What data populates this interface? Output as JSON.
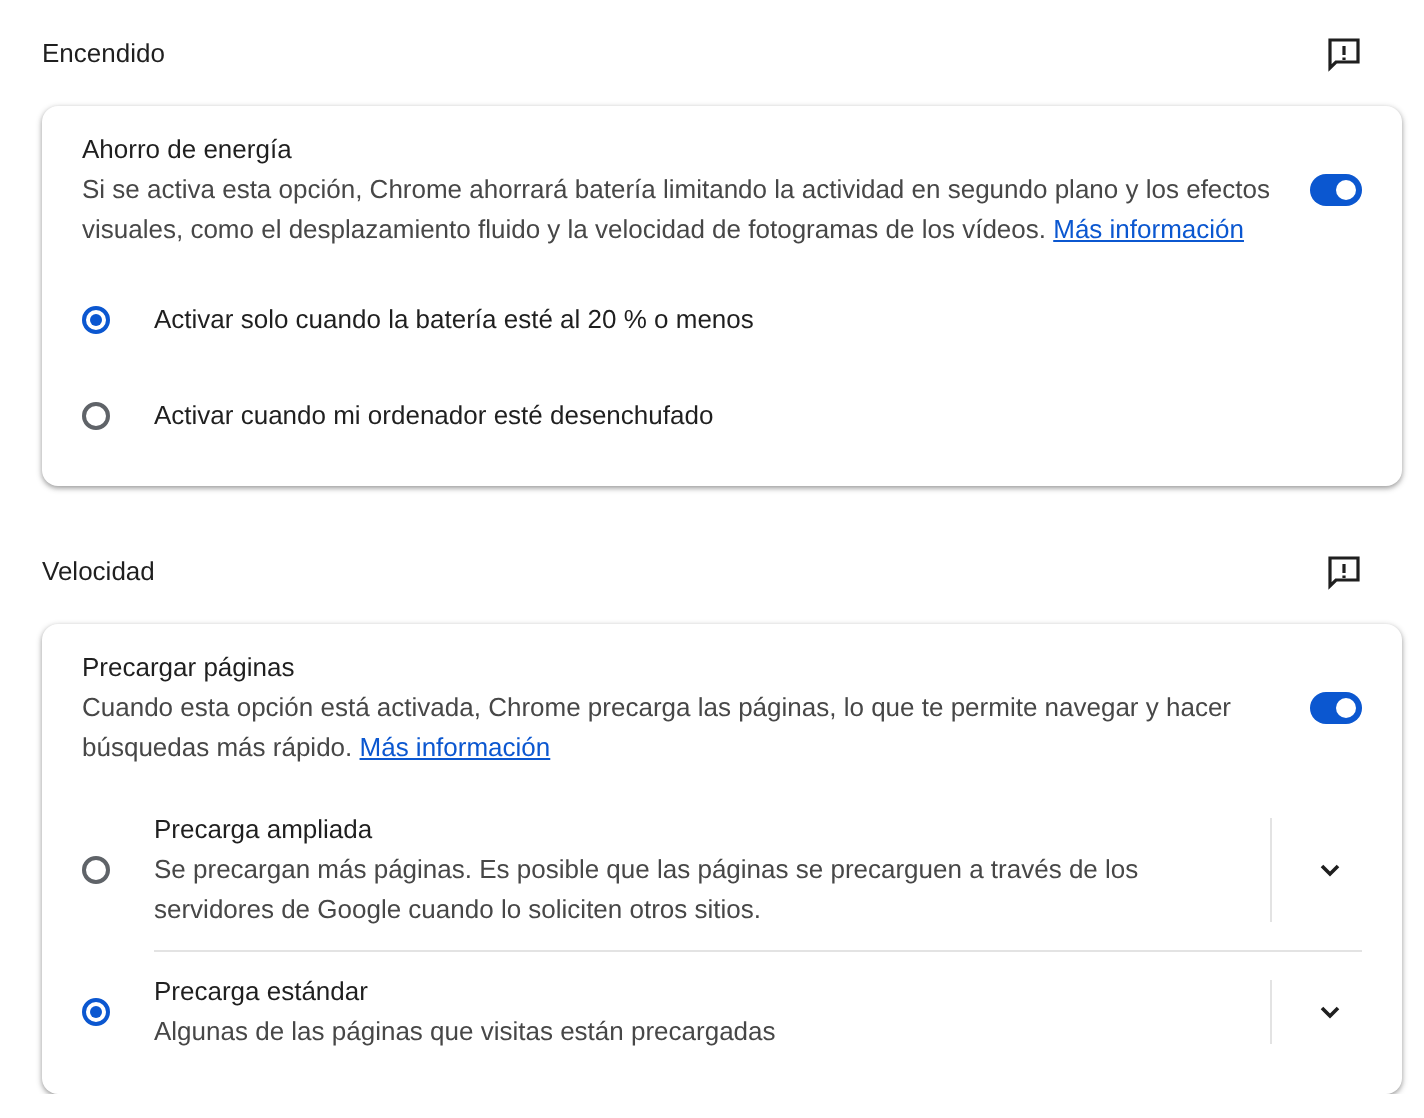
{
  "sections": [
    {
      "title": "Encendido",
      "setting": {
        "title": "Ahorro de energía",
        "description": "Si se activa esta opción, Chrome ahorrará batería limitando la actividad en segundo plano y los efectos visuales, como el desplazamiento fluido y la velocidad de fotogramas de los vídeos.",
        "link": "Más información",
        "on": true
      },
      "options": [
        {
          "kind": "simple",
          "label": "Activar solo cuando la batería esté al 20 % o menos",
          "selected": true
        },
        {
          "kind": "simple",
          "label": "Activar cuando mi ordenador esté desenchufado",
          "selected": false
        }
      ]
    },
    {
      "title": "Velocidad",
      "setting": {
        "title": "Precargar páginas",
        "description": "Cuando esta opción está activada, Chrome precarga las páginas, lo que te permite navegar y hacer búsquedas más rápido.",
        "link": "Más información",
        "on": true
      },
      "options": [
        {
          "kind": "expandable",
          "label": "Precarga ampliada",
          "description": "Se precargan más páginas. Es posible que las páginas se precarguen a través de los servidores de Google cuando lo soliciten otros sitios.",
          "selected": false
        },
        {
          "kind": "expandable",
          "label": "Precarga estándar",
          "description": "Algunas de las páginas que visitas están precargadas",
          "selected": true
        }
      ]
    }
  ]
}
